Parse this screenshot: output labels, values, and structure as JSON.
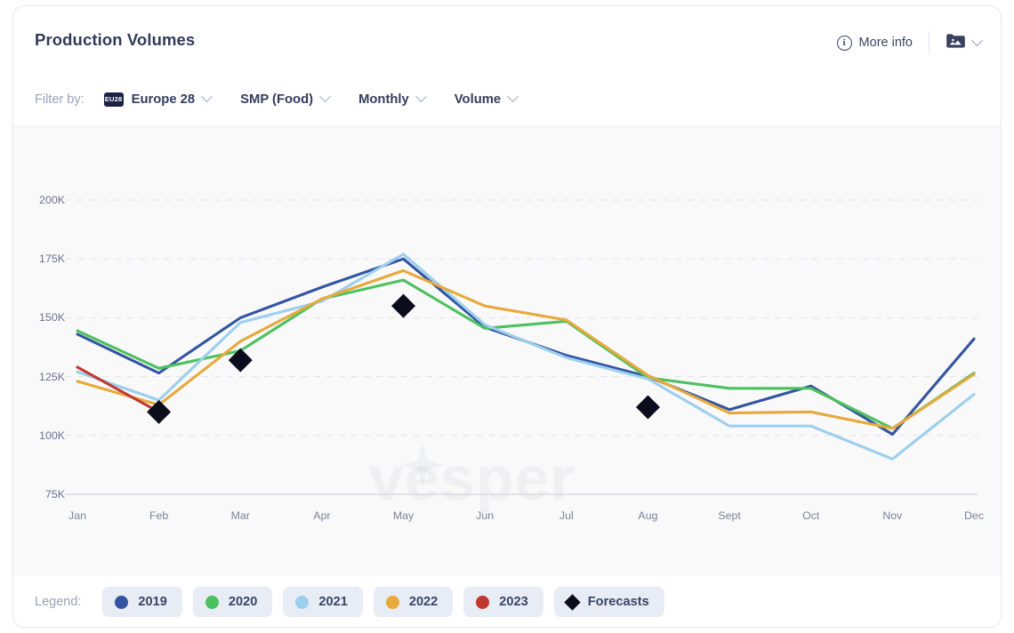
{
  "header": {
    "title": "Production Volumes",
    "more_info_label": "More info",
    "info_icon": "info-circle-icon",
    "export_icon": "image-folder-icon",
    "export_chevron_icon": "chevron-down-icon"
  },
  "filters": {
    "label": "Filter by:",
    "items": [
      {
        "value": "Europe 28",
        "badge": "EU28",
        "icon": "eu28-badge-icon",
        "chevron": "chevron-down-icon"
      },
      {
        "value": "SMP (Food)",
        "badge": null,
        "icon": null,
        "chevron": "chevron-down-icon"
      },
      {
        "value": "Monthly",
        "badge": null,
        "icon": null,
        "chevron": "chevron-down-icon"
      },
      {
        "value": "Volume",
        "badge": null,
        "icon": null,
        "chevron": "chevron-down-icon"
      }
    ]
  },
  "legend": {
    "label": "Legend:",
    "items": [
      {
        "label": "2019",
        "color": "#3355a1",
        "marker": "dot"
      },
      {
        "label": "2020",
        "color": "#4cc15f",
        "marker": "dot"
      },
      {
        "label": "2021",
        "color": "#9dcfee",
        "marker": "dot"
      },
      {
        "label": "2022",
        "color": "#e8a93c",
        "marker": "dot"
      },
      {
        "label": "2023",
        "color": "#c0392f",
        "marker": "dot"
      },
      {
        "label": "Forecasts",
        "color": "#0b0d1c",
        "marker": "diamond"
      }
    ]
  },
  "watermark": {
    "text": "vesper"
  },
  "chart_data": {
    "type": "line",
    "title": "Production Volumes",
    "xlabel": "",
    "ylabel": "",
    "ylim": [
      75000,
      200000
    ],
    "ytick_values": [
      200000,
      175000,
      150000,
      125000,
      100000,
      75000
    ],
    "ytick_labels": [
      "200K",
      "175K",
      "150K",
      "125K",
      "100K",
      "75K"
    ],
    "grid": true,
    "grid_style": "dashed-horizontal",
    "legend_position": "bottom",
    "categories": [
      "Jan",
      "Feb",
      "Mar",
      "Apr",
      "May",
      "Jun",
      "Jul",
      "Aug",
      "Sept",
      "Oct",
      "Nov",
      "Dec"
    ],
    "series": [
      {
        "name": "2019",
        "color": "#3355a1",
        "values": [
          143000,
          126500,
          150000,
          163000,
          175000,
          146000,
          134000,
          125000,
          111000,
          121000,
          100500,
          141000
        ]
      },
      {
        "name": "2020",
        "color": "#4cc15f",
        "values": [
          144500,
          128500,
          136000,
          158000,
          166000,
          145500,
          148500,
          124500,
          120000,
          120000,
          103000,
          126500
        ]
      },
      {
        "name": "2021",
        "color": "#9dcfee",
        "values": [
          127000,
          115000,
          148000,
          157000,
          177000,
          147000,
          133000,
          124000,
          104000,
          104000,
          90000,
          117500
        ]
      },
      {
        "name": "2022",
        "color": "#e8a93c",
        "values": [
          123000,
          113000,
          140000,
          158000,
          170000,
          155000,
          149000,
          125500,
          109500,
          110000,
          103000,
          126000
        ]
      },
      {
        "name": "2023",
        "color": "#c0392f",
        "values": [
          129000,
          110000,
          null,
          null,
          null,
          null,
          null,
          null,
          null,
          null,
          null,
          null
        ]
      },
      {
        "name": "Forecasts",
        "color": "#0b0d1c",
        "marker": "diamond",
        "values": [
          null,
          110000,
          132000,
          null,
          155000,
          null,
          null,
          112000,
          null,
          null,
          null,
          null
        ]
      }
    ]
  }
}
